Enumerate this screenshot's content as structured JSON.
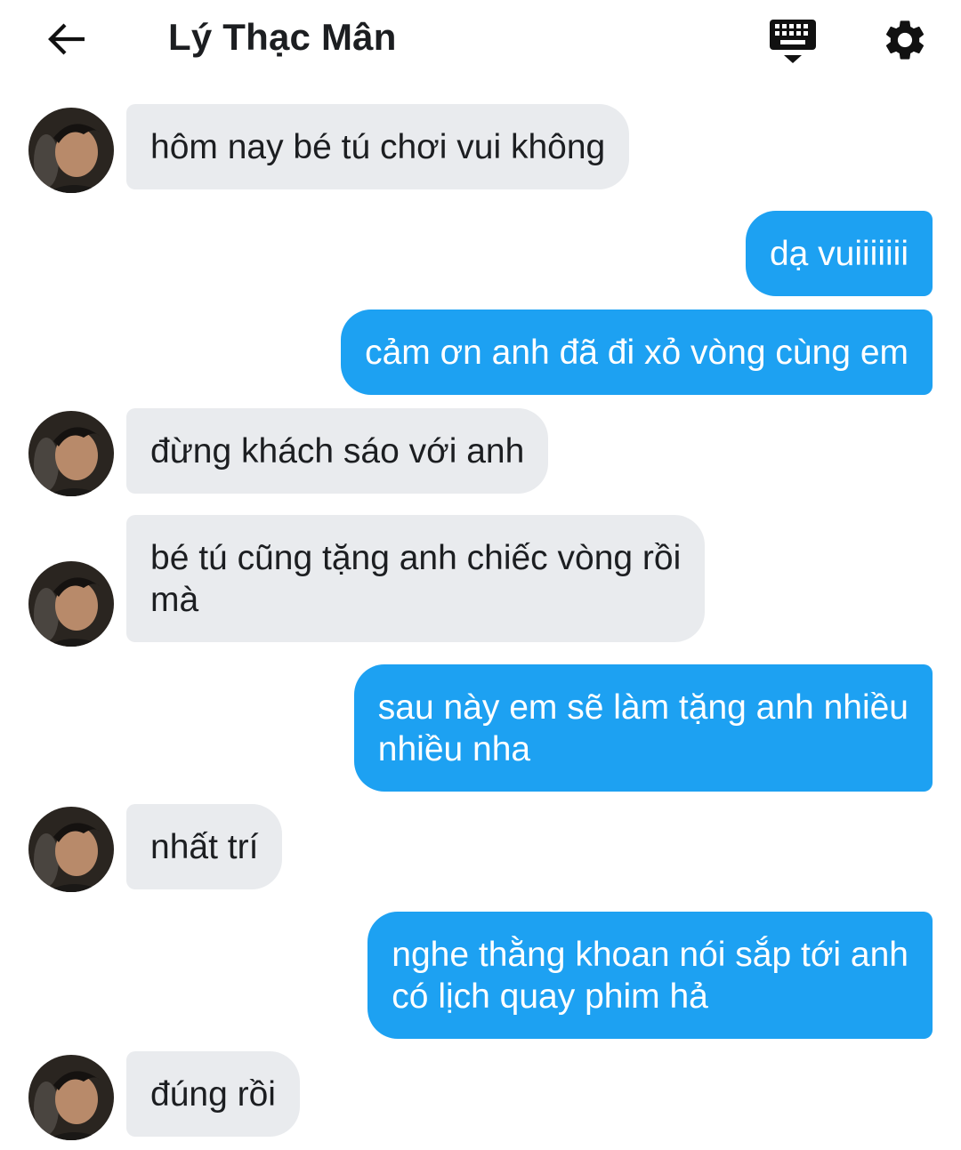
{
  "header": {
    "title": "Lý Thạc Mân",
    "back_icon": "arrow-left-icon",
    "keyboard_icon": "keyboard-toggle-icon",
    "settings_icon": "gear-icon"
  },
  "colors": {
    "outgoing_bubble": "#1da1f2",
    "incoming_bubble": "#e9ebee"
  },
  "messages": [
    {
      "direction": "incoming",
      "text": "hôm nay bé tú chơi vui không"
    },
    {
      "direction": "outgoing",
      "text": "dạ vuiiiiiii"
    },
    {
      "direction": "outgoing",
      "text": "cảm ơn anh đã đi xỏ vòng cùng em"
    },
    {
      "direction": "incoming",
      "text": "đừng khách sáo với anh"
    },
    {
      "direction": "incoming",
      "text": "bé tú cũng tặng anh chiếc vòng rồi\nmà"
    },
    {
      "direction": "outgoing",
      "text": "sau này em sẽ làm tặng anh nhiều\nnhiều nha"
    },
    {
      "direction": "incoming",
      "text": "nhất trí"
    },
    {
      "direction": "outgoing",
      "text": "nghe thằng khoan nói sắp tới anh\ncó lịch quay phim hả"
    },
    {
      "direction": "incoming",
      "text": "đúng rồi"
    }
  ]
}
